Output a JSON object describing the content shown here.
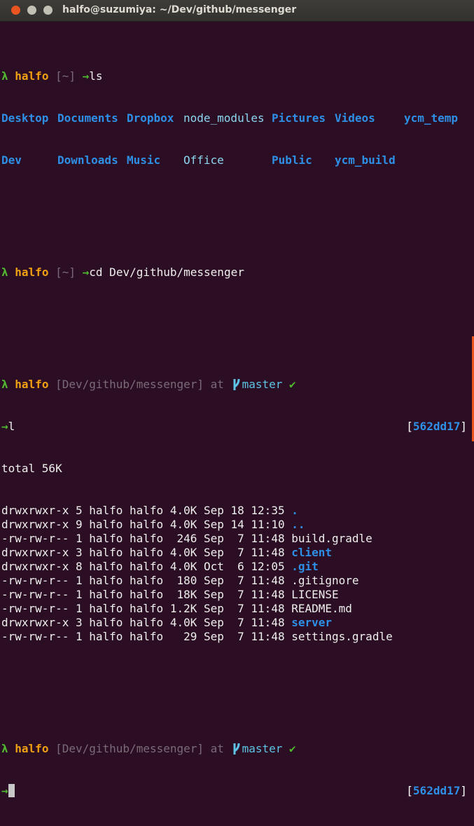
{
  "window": {
    "title": "halfo@suzumiya: ~/Dev/github/messenger",
    "accent": "#e95420",
    "background": "#2c0e24"
  },
  "prompt": {
    "lambda": "λ",
    "user": "halfo",
    "arrow": "→",
    "at": "at",
    "check": "✔",
    "branch_icon": "git-branch-icon"
  },
  "block1": {
    "cwd": "[~]",
    "command": "ls",
    "ls_output": [
      [
        "Desktop",
        "Documents",
        "Dropbox",
        "node_modules",
        "Pictures",
        "Videos",
        "ycm_temp"
      ],
      [
        "Dev",
        "Downloads",
        "Music",
        "Office",
        "Public",
        "ycm_build"
      ]
    ]
  },
  "block2": {
    "cwd": "[~]",
    "command": "cd Dev/github/messenger"
  },
  "block3": {
    "cwd": "[Dev/github/messenger]",
    "branch": "master",
    "command": "l",
    "commit": "562dd17",
    "total": "total 56K",
    "rows": [
      {
        "perms": "drwxrwxr-x",
        "links": "5",
        "owner": "halfo",
        "group": "halfo",
        "size": "4.0K",
        "month": "Sep",
        "day": "18",
        "time": "12:35",
        "name": ".",
        "type": "dir"
      },
      {
        "perms": "drwxrwxr-x",
        "links": "9",
        "owner": "halfo",
        "group": "halfo",
        "size": "4.0K",
        "month": "Sep",
        "day": "14",
        "time": "11:10",
        "name": "..",
        "type": "dir"
      },
      {
        "perms": "-rw-rw-r--",
        "links": "1",
        "owner": "halfo",
        "group": "halfo",
        "size": "246",
        "month": "Sep",
        "day": "7",
        "time": "11:48",
        "name": "build.gradle",
        "type": "file"
      },
      {
        "perms": "drwxrwxr-x",
        "links": "3",
        "owner": "halfo",
        "group": "halfo",
        "size": "4.0K",
        "month": "Sep",
        "day": "7",
        "time": "11:48",
        "name": "client",
        "type": "dir"
      },
      {
        "perms": "drwxrwxr-x",
        "links": "8",
        "owner": "halfo",
        "group": "halfo",
        "size": "4.0K",
        "month": "Oct",
        "day": "6",
        "time": "12:05",
        "name": ".git",
        "type": "dir"
      },
      {
        "perms": "-rw-rw-r--",
        "links": "1",
        "owner": "halfo",
        "group": "halfo",
        "size": "180",
        "month": "Sep",
        "day": "7",
        "time": "11:48",
        "name": ".gitignore",
        "type": "file"
      },
      {
        "perms": "-rw-rw-r--",
        "links": "1",
        "owner": "halfo",
        "group": "halfo",
        "size": "18K",
        "month": "Sep",
        "day": "7",
        "time": "11:48",
        "name": "LICENSE",
        "type": "file"
      },
      {
        "perms": "-rw-rw-r--",
        "links": "1",
        "owner": "halfo",
        "group": "halfo",
        "size": "1.2K",
        "month": "Sep",
        "day": "7",
        "time": "11:48",
        "name": "README.md",
        "type": "file"
      },
      {
        "perms": "drwxrwxr-x",
        "links": "3",
        "owner": "halfo",
        "group": "halfo",
        "size": "4.0K",
        "month": "Sep",
        "day": "7",
        "time": "11:48",
        "name": "server",
        "type": "dir"
      },
      {
        "perms": "-rw-rw-r--",
        "links": "1",
        "owner": "halfo",
        "group": "halfo",
        "size": "29",
        "month": "Sep",
        "day": "7",
        "time": "11:48",
        "name": "settings.gradle",
        "type": "file"
      }
    ]
  },
  "block4": {
    "cwd": "[Dev/github/messenger]",
    "branch": "master",
    "commit": "562dd17"
  }
}
